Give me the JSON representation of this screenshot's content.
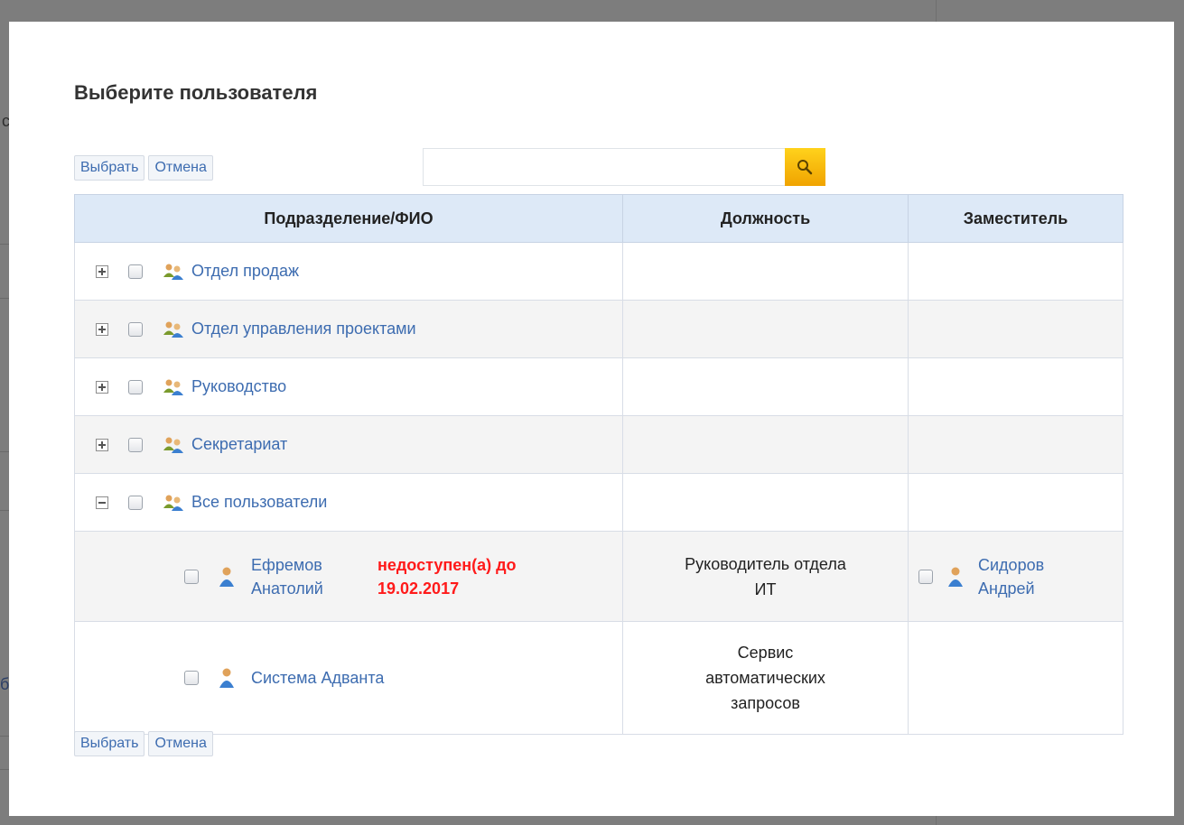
{
  "background": {
    "fragments": [
      "ст",
      "ба"
    ]
  },
  "dialog": {
    "title": "Выберите пользователя",
    "select_label": "Выбрать",
    "cancel_label": "Отмена",
    "search": {
      "value": "",
      "placeholder": ""
    }
  },
  "table": {
    "headers": [
      "Подразделение/ФИО",
      "Должность",
      "Заместитель"
    ],
    "groups": [
      {
        "name": "Отдел продаж",
        "expander": "+"
      },
      {
        "name": "Отдел управления проектами",
        "expander": "+"
      },
      {
        "name": "Руководство",
        "expander": "+"
      },
      {
        "name": "Секретариат",
        "expander": "+"
      },
      {
        "name": "Все пользователи",
        "expander": "−"
      }
    ],
    "users": [
      {
        "name_line1": "Ефремов",
        "name_line2": "Анатолий",
        "status_line1": "недоступен(а) до",
        "status_line2": "19.02.2017",
        "position_line1": "Руководитель отдела",
        "position_line2": "ИТ",
        "deputy_line1": "Сидоров",
        "deputy_line2": "Андрей"
      },
      {
        "name": "Система Адванта",
        "position_line1": "Сервис",
        "position_line2": "автоматических",
        "position_line3": "запросов"
      }
    ]
  },
  "colors": {
    "accent": "#3d6cb0",
    "warning": "#ff1a1a",
    "header_bg": "#dde9f7",
    "search_button": "#f5b400"
  },
  "icons": {
    "group": "group-users-icon",
    "user": "user-icon",
    "search": "magnifier-icon"
  }
}
